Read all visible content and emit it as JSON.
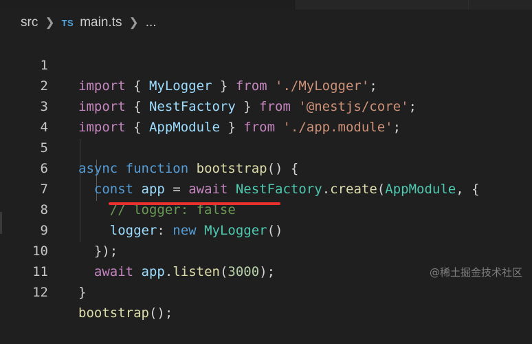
{
  "breadcrumb": {
    "folder": "src",
    "file_icon": "TS",
    "file": "main.ts",
    "more": "..."
  },
  "lines": [
    {
      "n": "1",
      "t": [
        "import",
        " { ",
        "MyLogger",
        " } ",
        "from",
        " ",
        "'./MyLogger'",
        ";"
      ]
    },
    {
      "n": "2",
      "t": [
        "import",
        " { ",
        "NestFactory",
        " } ",
        "from",
        " ",
        "'@nestjs/core'",
        ";"
      ]
    },
    {
      "n": "3",
      "t": [
        "import",
        " { ",
        "AppModule",
        " } ",
        "from",
        " ",
        "'./app.module'",
        ";"
      ]
    },
    {
      "n": "4",
      "t": []
    },
    {
      "n": "5",
      "t": [
        "async",
        " ",
        "function",
        " ",
        "bootstrap",
        "() {"
      ]
    },
    {
      "n": "6",
      "t": [
        "  ",
        "const",
        " ",
        "app",
        " = ",
        "await",
        " ",
        "NestFactory",
        ".",
        "create",
        "(",
        "AppModule",
        ", {"
      ]
    },
    {
      "n": "7",
      "t": [
        "    ",
        "// logger: false"
      ]
    },
    {
      "n": "8",
      "t": [
        "    ",
        "logger",
        ": ",
        "new",
        " ",
        "MyLogger",
        "()"
      ]
    },
    {
      "n": "9",
      "t": [
        "  ",
        "});"
      ]
    },
    {
      "n": "10",
      "t": [
        "  ",
        "await",
        " ",
        "app",
        ".",
        "listen",
        "(",
        "3000",
        ");"
      ]
    },
    {
      "n": "11",
      "t": [
        "}"
      ]
    },
    {
      "n": "12",
      "t": [
        "bootstrap",
        "();"
      ]
    }
  ],
  "watermark": "@稀土掘金技术社区",
  "colors": {
    "background": "#1f1f1f",
    "keyword": "#569cd6",
    "control": "#c586c0",
    "string": "#ce9178",
    "class": "#4ec9b0",
    "function": "#dcdcaa",
    "variable": "#9cdcfe",
    "number": "#b5cea8",
    "comment": "#6a9955",
    "highlight_underline": "#e8312e"
  }
}
